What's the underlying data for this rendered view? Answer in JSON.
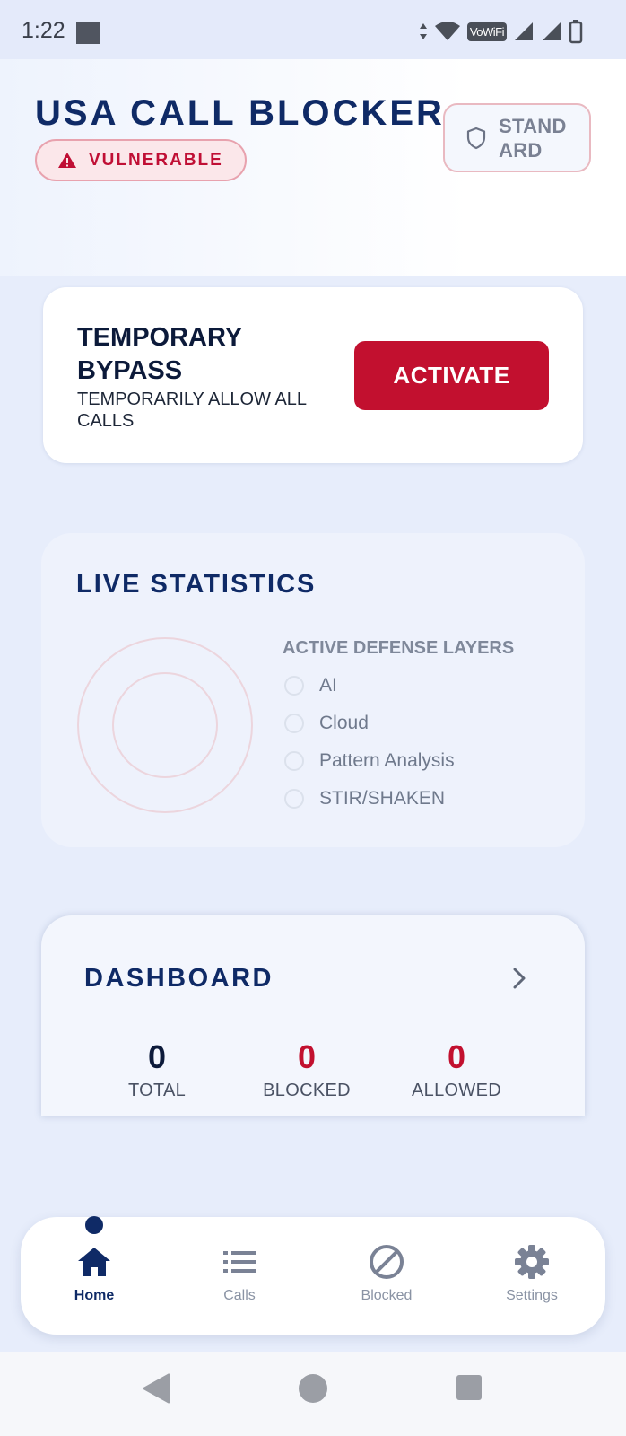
{
  "status_bar": {
    "time": "1:22",
    "network_label": "VoWiFi"
  },
  "header": {
    "app_title": "USA CALL BLOCKER",
    "status_badge": "VULNERABLE",
    "mode_button": "STANDARD"
  },
  "bypass": {
    "title": "TEMPORARY BYPASS",
    "description": "TEMPORARILY ALLOW ALL CALLS",
    "button_label": "ACTIVATE"
  },
  "live_stats": {
    "title": "LIVE STATISTICS",
    "layers_title": "ACTIVE DEFENSE LAYERS",
    "layers": [
      "AI",
      "Cloud",
      "Pattern Analysis",
      "STIR/SHAKEN"
    ]
  },
  "dashboard": {
    "title": "DASHBOARD",
    "metrics": [
      {
        "value": "0",
        "label": "TOTAL"
      },
      {
        "value": "0",
        "label": "BLOCKED"
      },
      {
        "value": "0",
        "label": "ALLOWED"
      }
    ]
  },
  "bottom_nav": {
    "items": [
      {
        "label": "Home",
        "icon": "home-icon",
        "active": true
      },
      {
        "label": "Calls",
        "icon": "list-icon",
        "active": false
      },
      {
        "label": "Blocked",
        "icon": "block-icon",
        "active": false
      },
      {
        "label": "Settings",
        "icon": "gear-icon",
        "active": false
      }
    ]
  },
  "colors": {
    "brand_navy": "#0f2a66",
    "alert_red": "#c2102f",
    "background": "#e7edfb"
  }
}
